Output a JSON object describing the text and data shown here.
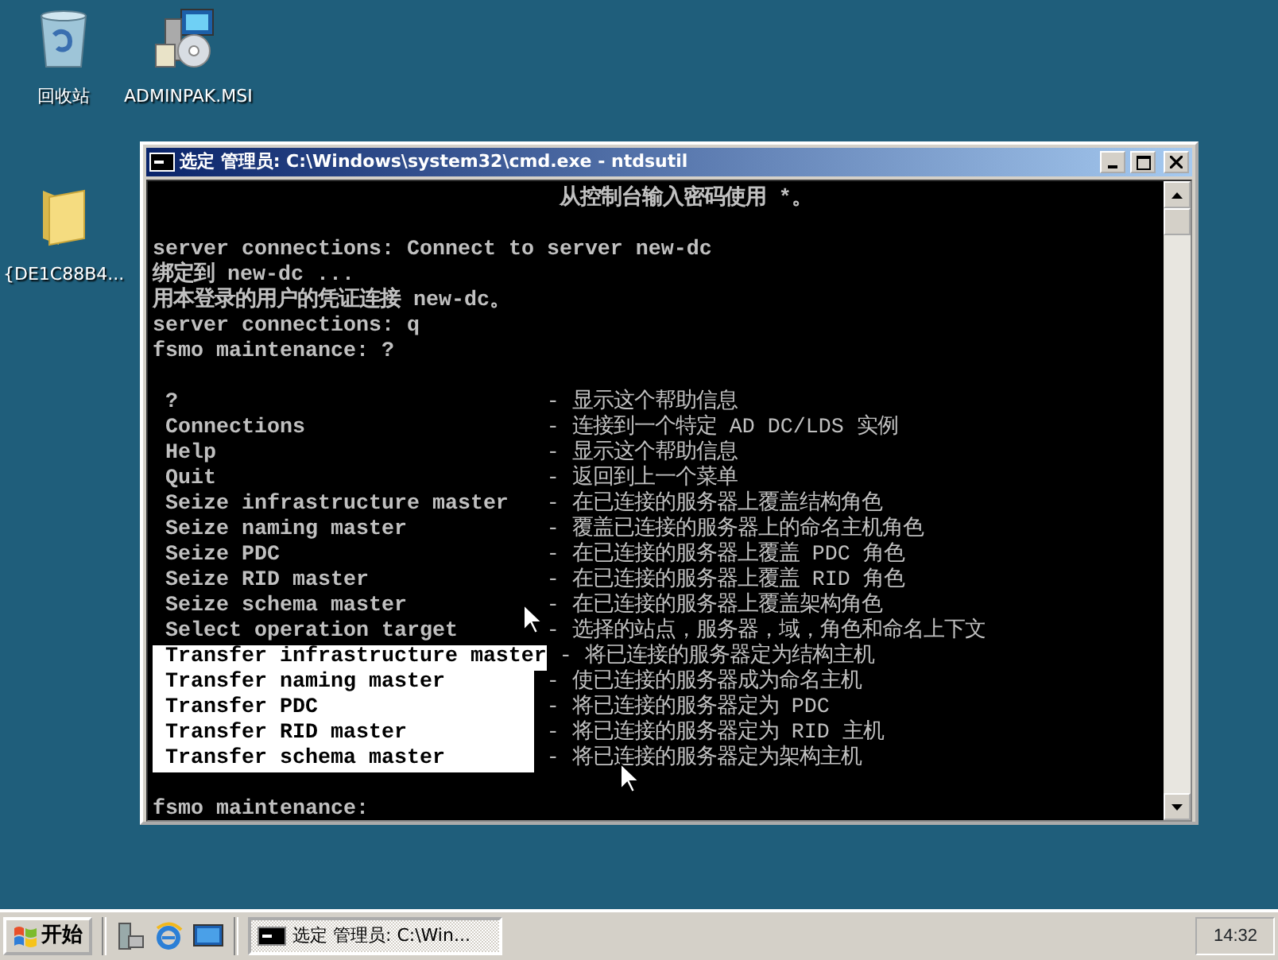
{
  "desktop_icons": [
    {
      "label": "回收站",
      "kind": "recycle"
    },
    {
      "label": "ADMINPAK.MSI",
      "kind": "installer"
    },
    {
      "label": "{DE1C88B4...",
      "kind": "folder"
    }
  ],
  "window": {
    "title": "选定 管理员: C:\\Windows\\system32\\cmd.exe - ntdsutil"
  },
  "console": {
    "lines": [
      {
        "kind": "continued",
        "text": "从控制台输入密码使用 *。"
      },
      {
        "kind": "blank"
      },
      {
        "kind": "text",
        "text": "server connections: Connect to server new-dc"
      },
      {
        "kind": "text",
        "text": "绑定到 new-dc ..."
      },
      {
        "kind": "text",
        "text": "用本登录的用户的凭证连接 new-dc。"
      },
      {
        "kind": "text",
        "text": "server connections: q"
      },
      {
        "kind": "text",
        "text": "fsmo maintenance: ?"
      },
      {
        "kind": "blank"
      }
    ],
    "commands": [
      {
        "name": "?",
        "description": "- 显示这个帮助信息",
        "selected": false
      },
      {
        "name": "Connections",
        "description": "- 连接到一个特定 AD DC/LDS 实例",
        "selected": false
      },
      {
        "name": "Help",
        "description": "- 显示这个帮助信息",
        "selected": false
      },
      {
        "name": "Quit",
        "description": "- 返回到上一个菜单",
        "selected": false
      },
      {
        "name": "Seize infrastructure master",
        "description": "- 在已连接的服务器上覆盖结构角色",
        "selected": false
      },
      {
        "name": "Seize naming master",
        "description": "- 覆盖已连接的服务器上的命名主机角色",
        "selected": false
      },
      {
        "name": "Seize PDC",
        "description": "- 在已连接的服务器上覆盖 PDC 角色",
        "selected": false
      },
      {
        "name": "Seize RID master",
        "description": "- 在已连接的服务器上覆盖 RID 角色",
        "selected": false
      },
      {
        "name": "Seize schema master",
        "description": "- 在已连接的服务器上覆盖架构角色",
        "selected": false
      },
      {
        "name": "Select operation target",
        "description": "- 选择的站点，服务器，域，角色和命名上下文",
        "selected": false
      },
      {
        "name": "Transfer infrastructure master",
        "description": "- 将已连接的服务器定为结构主机",
        "selected": true
      },
      {
        "name": "Transfer naming master",
        "description": "- 使已连接的服务器成为命名主机",
        "selected": true
      },
      {
        "name": "Transfer PDC",
        "description": "- 将已连接的服务器定为 PDC",
        "selected": true
      },
      {
        "name": "Transfer RID master",
        "description": "- 将已连接的服务器定为 RID 主机",
        "selected": true
      },
      {
        "name": "Transfer schema master",
        "description": "- 将已连接的服务器定为架构主机",
        "selected": true
      }
    ],
    "prompt": "fsmo maintenance:"
  },
  "taskbar": {
    "start": "开始",
    "quick_launch": [
      {
        "kind": "server"
      },
      {
        "kind": "browser"
      },
      {
        "kind": "desktop"
      }
    ],
    "tasks": [
      {
        "label": "选定 管理员: C:\\Win...",
        "selected": true
      }
    ],
    "clock": "14:32"
  }
}
